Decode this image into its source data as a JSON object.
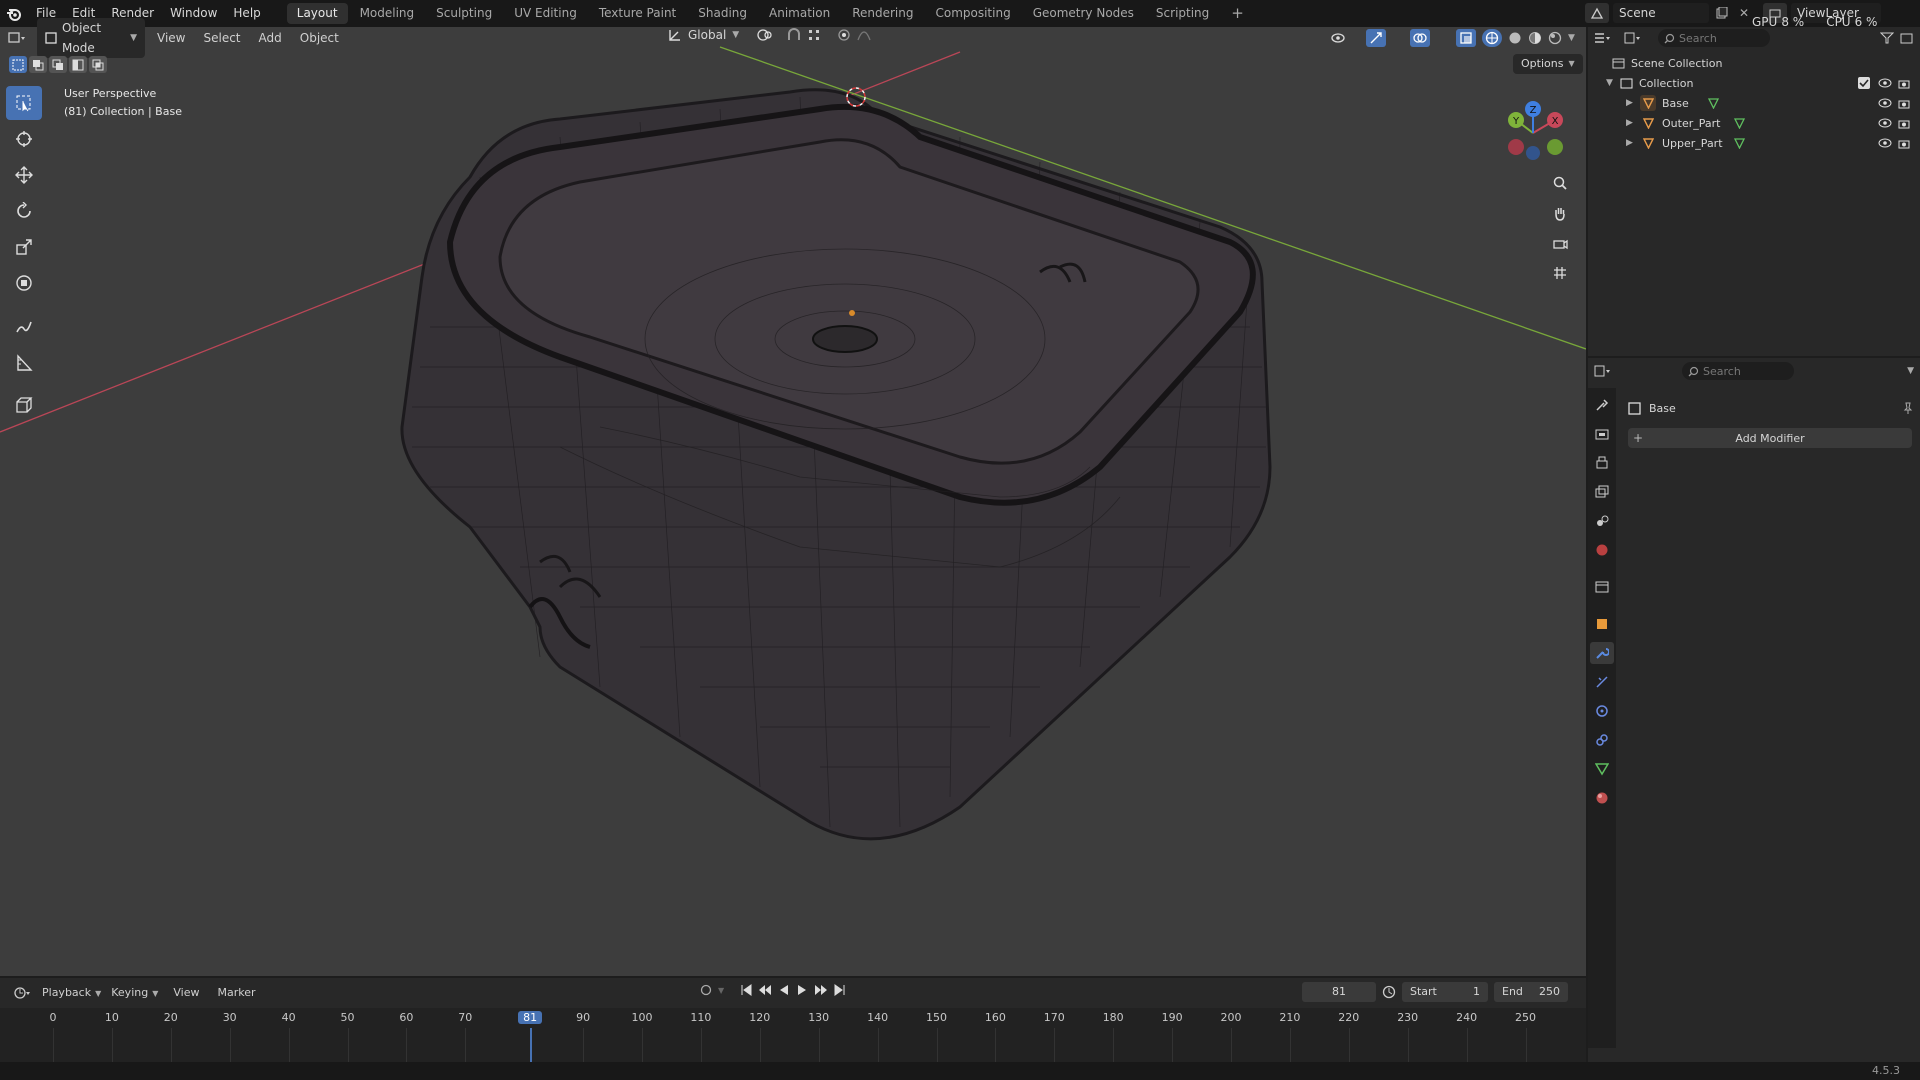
{
  "topbar": {
    "menus": [
      "File",
      "Edit",
      "Render",
      "Window",
      "Help"
    ],
    "workspaces": [
      "Layout",
      "Modeling",
      "Sculpting",
      "UV Editing",
      "Texture Paint",
      "Shading",
      "Animation",
      "Rendering",
      "Compositing",
      "Geometry Nodes",
      "Scripting"
    ],
    "active_workspace": "Layout",
    "add_label": "+",
    "scene": "Scene",
    "view_layer": "ViewLayer",
    "gpu": "GPU",
    "gpu_val": "8 %",
    "cpu": "CPU",
    "cpu_val": "6 %"
  },
  "viewport": {
    "mode": "Object Mode",
    "menus": [
      "View",
      "Select",
      "Add",
      "Object"
    ],
    "orientation": "Global",
    "options": "Options",
    "overlay_title": "User Perspective",
    "overlay_sub": "(81) Collection | Base",
    "gizmo": {
      "x": "X",
      "y": "Y",
      "z": "Z"
    }
  },
  "outliner": {
    "search_placeholder": "Search",
    "scene_collection": "Scene Collection",
    "collection": "Collection",
    "objects": [
      "Base",
      "Outer_Part",
      "Upper_Part"
    ]
  },
  "properties": {
    "search_placeholder": "Search",
    "object_name": "Base",
    "add_modifier": "Add Modifier"
  },
  "timeline": {
    "menus": [
      "Playback",
      "Keying",
      "View",
      "Marker"
    ],
    "current_frame": "81",
    "start_label": "Start",
    "start": "1",
    "end_label": "End",
    "end": "250",
    "ticks": [
      "0",
      "10",
      "20",
      "30",
      "40",
      "50",
      "60",
      "70",
      "81",
      "90",
      "100",
      "110",
      "120",
      "130",
      "140",
      "150",
      "160",
      "170",
      "180",
      "190",
      "200",
      "210",
      "220",
      "230",
      "240",
      "250"
    ]
  },
  "status": {
    "version": "4.5.3"
  },
  "colors": {
    "accent": "#4772b3",
    "x_axis": "#c8485a",
    "y_axis": "#7fb33a",
    "z_axis": "#3f7fe0"
  }
}
